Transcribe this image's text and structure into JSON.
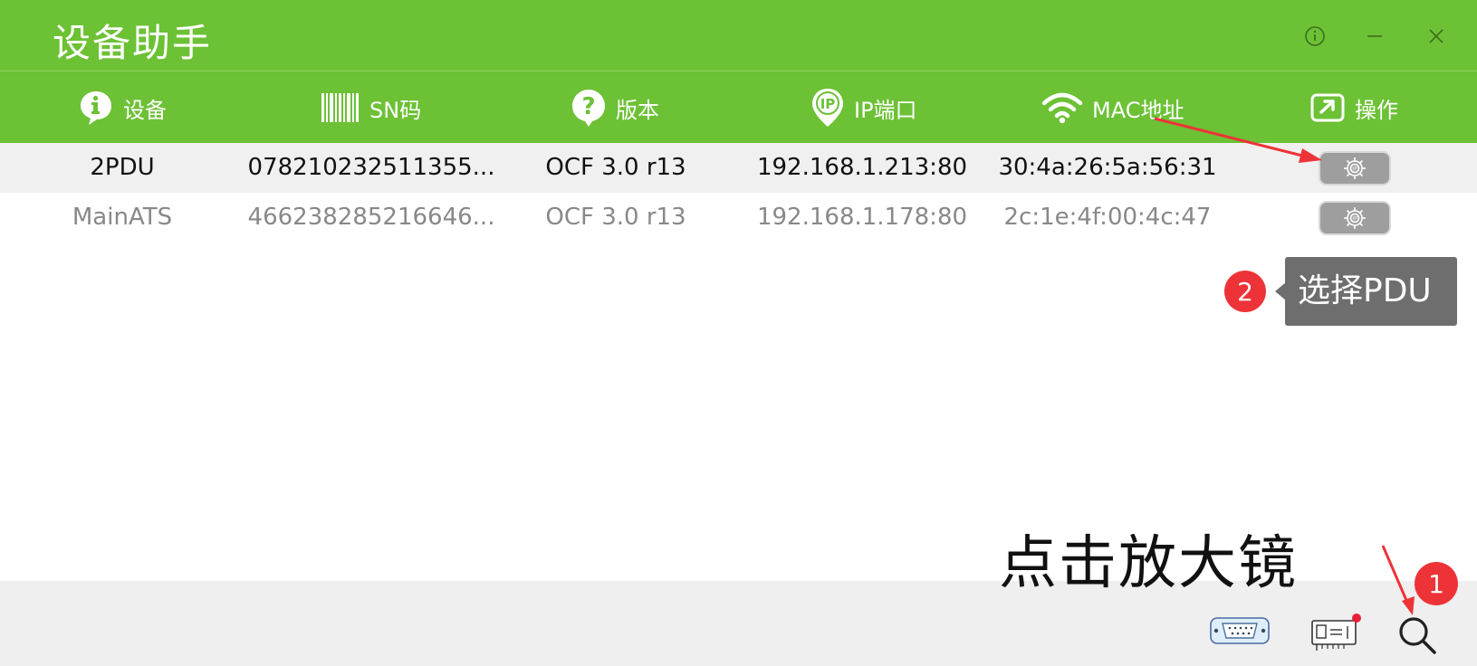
{
  "window": {
    "title": "设备助手",
    "controls": [
      "info-icon",
      "minimize-icon",
      "close-icon"
    ]
  },
  "columns": [
    {
      "label": "设备",
      "icon": "device-info-bubble-icon"
    },
    {
      "label": "SN码",
      "icon": "barcode-icon"
    },
    {
      "label": "版本",
      "icon": "question-bubble-icon"
    },
    {
      "label": "IP端口",
      "icon": "ip-pin-icon"
    },
    {
      "label": "MAC地址",
      "icon": "wifi-icon"
    },
    {
      "label": "操作",
      "icon": "external-link-icon"
    }
  ],
  "rows": [
    {
      "device": "2PDU",
      "sn": "078210232511355...",
      "version": "OCF 3.0 r13",
      "ip_port": "192.168.1.213:80",
      "mac": "30:4a:26:5a:56:31",
      "action_icon": "ip-gear-icon",
      "selected": true
    },
    {
      "device": "MainATS",
      "sn": "466238285216646...",
      "version": "OCF 3.0 r13",
      "ip_port": "192.168.1.178:80",
      "mac": "2c:1e:4f:00:4c:47",
      "action_icon": "ip-gear-icon",
      "selected": false
    }
  ],
  "annotations": {
    "step1_badge": "1",
    "step1_text": "点击放大镜",
    "step2_badge": "2",
    "step2_text": "选择PDU"
  },
  "bottom_toolbar": {
    "icons": [
      "serial-port-icon",
      "network-card-icon",
      "search-icon"
    ],
    "notification_dot": true
  },
  "colors": {
    "brand_green": "#6cc135",
    "annotation_red": "#ee3338",
    "tooltip_gray": "#6e6e6e",
    "selected_row": "#f0f0f0",
    "bottom_bar": "#efefef"
  }
}
